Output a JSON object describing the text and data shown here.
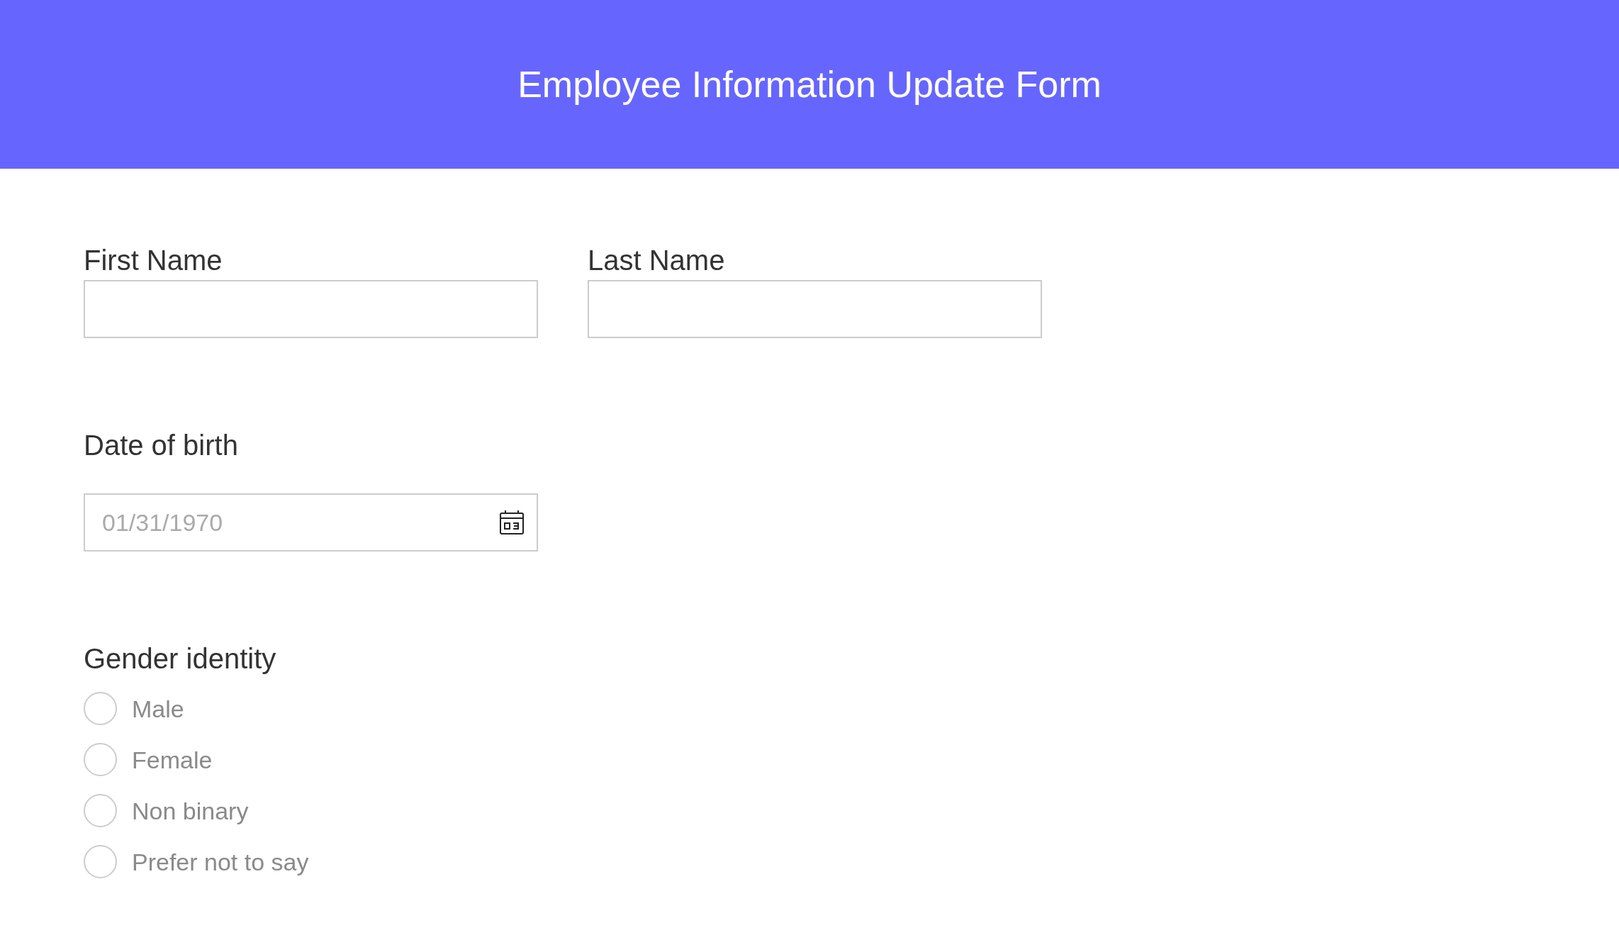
{
  "header": {
    "title": "Employee Information Update Form"
  },
  "name_fields": [
    {
      "label": "First Name"
    },
    {
      "label": "Last Name"
    }
  ],
  "date_of_birth": {
    "label": "Date of birth",
    "placeholder": "01/31/1970"
  },
  "gender_identity": {
    "label": "Gender identity",
    "options": [
      {
        "label": "Male",
        "selected": false
      },
      {
        "label": "Female",
        "selected": false
      },
      {
        "label": "Non binary",
        "selected": false
      },
      {
        "label": "Prefer not to say",
        "selected": false
      }
    ]
  }
}
